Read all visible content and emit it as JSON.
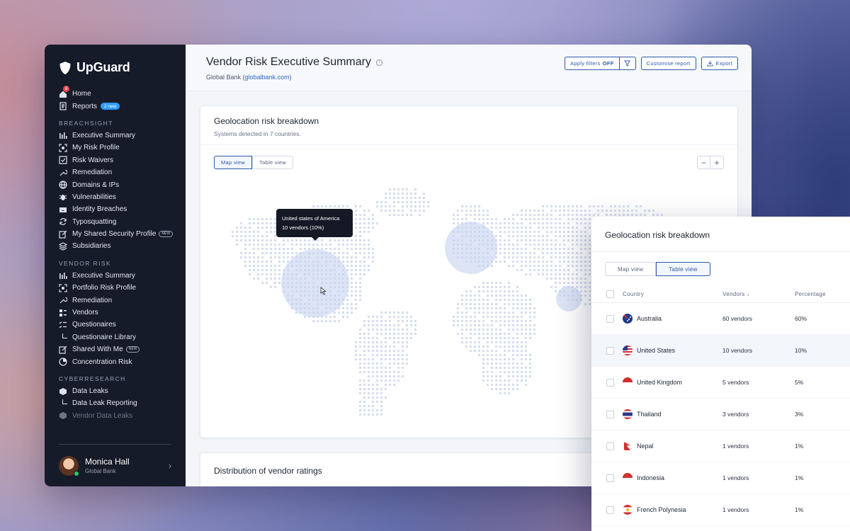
{
  "brand": {
    "name": "UpGuard"
  },
  "sidebar": {
    "top_items": [
      {
        "label": "Home",
        "icon": "home-icon",
        "notification_count": "8"
      },
      {
        "label": "Reports",
        "icon": "report-icon",
        "badge": "2 new"
      }
    ],
    "sections": [
      {
        "label": "BREACHSIGHT",
        "items": [
          {
            "label": "Executive Summary",
            "icon": "bar-chart-icon"
          },
          {
            "label": "My Risk Profile",
            "icon": "scan-icon"
          },
          {
            "label": "Risk Waivers",
            "icon": "checkbox-icon"
          },
          {
            "label": "Remediation",
            "icon": "wrench-icon"
          },
          {
            "label": "Domains & IPs",
            "icon": "globe-icon"
          },
          {
            "label": "Vulnerabilities",
            "icon": "bug-icon"
          },
          {
            "label": "Identity Breaches",
            "icon": "inbox-icon"
          },
          {
            "label": "Typosquatting",
            "icon": "refresh-icon"
          },
          {
            "label": "My Shared Security Profile",
            "icon": "edit-icon",
            "badge": "NEW"
          },
          {
            "label": "Subsidiaries",
            "icon": "layers-icon"
          }
        ]
      },
      {
        "label": "VENDOR RISK",
        "items": [
          {
            "label": "Executive Summary",
            "icon": "bar-chart-icon"
          },
          {
            "label": "Portfolio Risk Profile",
            "icon": "scan-icon"
          },
          {
            "label": "Remediation",
            "icon": "wrench-icon"
          },
          {
            "label": "Vendors",
            "icon": "list-icon"
          },
          {
            "label": "Questionaires",
            "icon": "checklist-icon"
          },
          {
            "label": "Questionaire Library",
            "sub": true
          },
          {
            "label": "Shared With Me",
            "icon": "edit-icon",
            "badge": "NEW"
          },
          {
            "label": "Concentration Risk",
            "icon": "pie-icon"
          }
        ]
      },
      {
        "label": "CYBERRESEARCH",
        "items": [
          {
            "label": "Data Leaks",
            "icon": "box-icon"
          },
          {
            "label": "Data Leak Reporting",
            "sub": true
          },
          {
            "label": "Vendor Data Leaks",
            "icon": "box-icon",
            "dim": true
          }
        ]
      }
    ],
    "user": {
      "name": "Monica Hall",
      "org": "Global Bank"
    }
  },
  "header": {
    "title": "Vendor Risk Executive Summary",
    "org_prefix": "Global Bank (",
    "org_link": "globalbank.com",
    "org_suffix": ")",
    "apply_filters_label": "Apply filters",
    "apply_filters_state": "OFF",
    "customise_label": "Customise report",
    "export_label": "Export"
  },
  "geo_card": {
    "title": "Geolocation risk breakdown",
    "subtitle": "Systems detected in 7 countries.",
    "map_view_label": "Map view",
    "table_view_label": "Table view",
    "zoom_out": "−",
    "zoom_in": "+",
    "tooltip_title": "United states of America",
    "tooltip_value": "10 vendors (10%)"
  },
  "dist_card": {
    "title": "Distribution of vendor ratings"
  },
  "overlay": {
    "title": "Geolocation risk breakdown",
    "map_view_label": "Map view",
    "table_view_label": "Table view",
    "columns": {
      "country": "Country",
      "vendors": "Vendors ↓",
      "percentage": "Percentage"
    },
    "rows": [
      {
        "country": "Australia",
        "flag": "flag-au",
        "vendors": "60 vendors",
        "percentage": "60%"
      },
      {
        "country": "United States",
        "flag": "flag-us",
        "vendors": "10 vendors",
        "percentage": "10%",
        "highlight": true
      },
      {
        "country": "United Kingdom",
        "flag": "flag-uk",
        "vendors": "5 vendors",
        "percentage": "5%"
      },
      {
        "country": "Thailand",
        "flag": "flag-th",
        "vendors": "3 vendors",
        "percentage": "3%"
      },
      {
        "country": "Nepal",
        "flag": "flag-np",
        "vendors": "1 vendors",
        "percentage": "1%"
      },
      {
        "country": "Indonesia",
        "flag": "flag-id",
        "vendors": "1 vendors",
        "percentage": "1%"
      },
      {
        "country": "French Polynesia",
        "flag": "flag-pf",
        "vendors": "1 vendors",
        "percentage": "1%"
      }
    ]
  },
  "colors": {
    "accent": "#2b5aa8",
    "sidebar_bg": "#161b29",
    "map_dot": "#d5dded",
    "bubble": "#c9d6f1"
  }
}
